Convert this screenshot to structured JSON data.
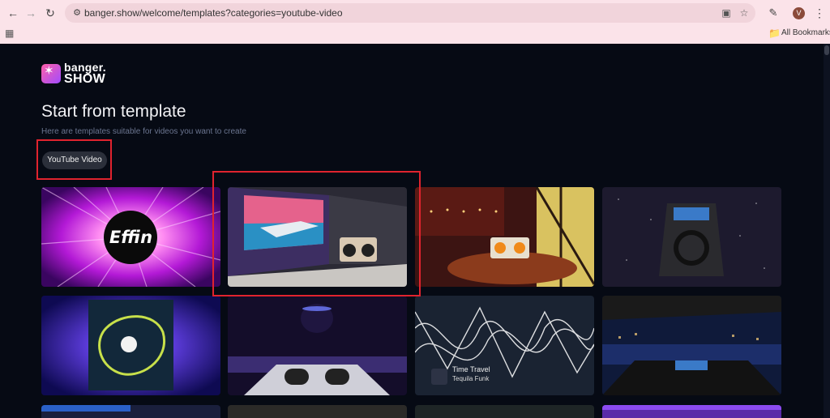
{
  "browser": {
    "url": "banger.show/welcome/templates?categories=youtube-video",
    "avatar_letter": "V",
    "bookmarks_label": "All Bookmarks",
    "icons": {
      "back": "back-arrow-icon",
      "forward": "forward-arrow-icon",
      "reload": "reload-icon",
      "site_settings": "site-settings-icon",
      "install": "install-app-icon",
      "bookmark": "bookmark-star-icon",
      "extensions": "extensions-icon",
      "menu": "more-menu-icon",
      "apps": "apps-grid-icon",
      "folder": "folder-icon"
    }
  },
  "logo": {
    "line1": "banger.",
    "line2": "SHOW"
  },
  "page": {
    "title": "Start from template",
    "subtitle": "Here are templates suitable for videos you want to create"
  },
  "filter": {
    "label": "YouTube Video"
  },
  "templates": [
    {
      "label": "Effin",
      "overlay": ""
    },
    {
      "label": "",
      "overlay": ""
    },
    {
      "label": "",
      "overlay": ""
    },
    {
      "label": "",
      "overlay": ""
    },
    {
      "label": "",
      "overlay": ""
    },
    {
      "label": "",
      "overlay": ""
    },
    {
      "label": "Time Travel",
      "overlay": "Tequila Funk"
    },
    {
      "label": "",
      "overlay": ""
    }
  ],
  "colors": {
    "highlight": "#e0232e",
    "page_bg": "#060a14",
    "chrome_bg": "#fbe3e9",
    "chip_bg": "#2b2f3a"
  }
}
